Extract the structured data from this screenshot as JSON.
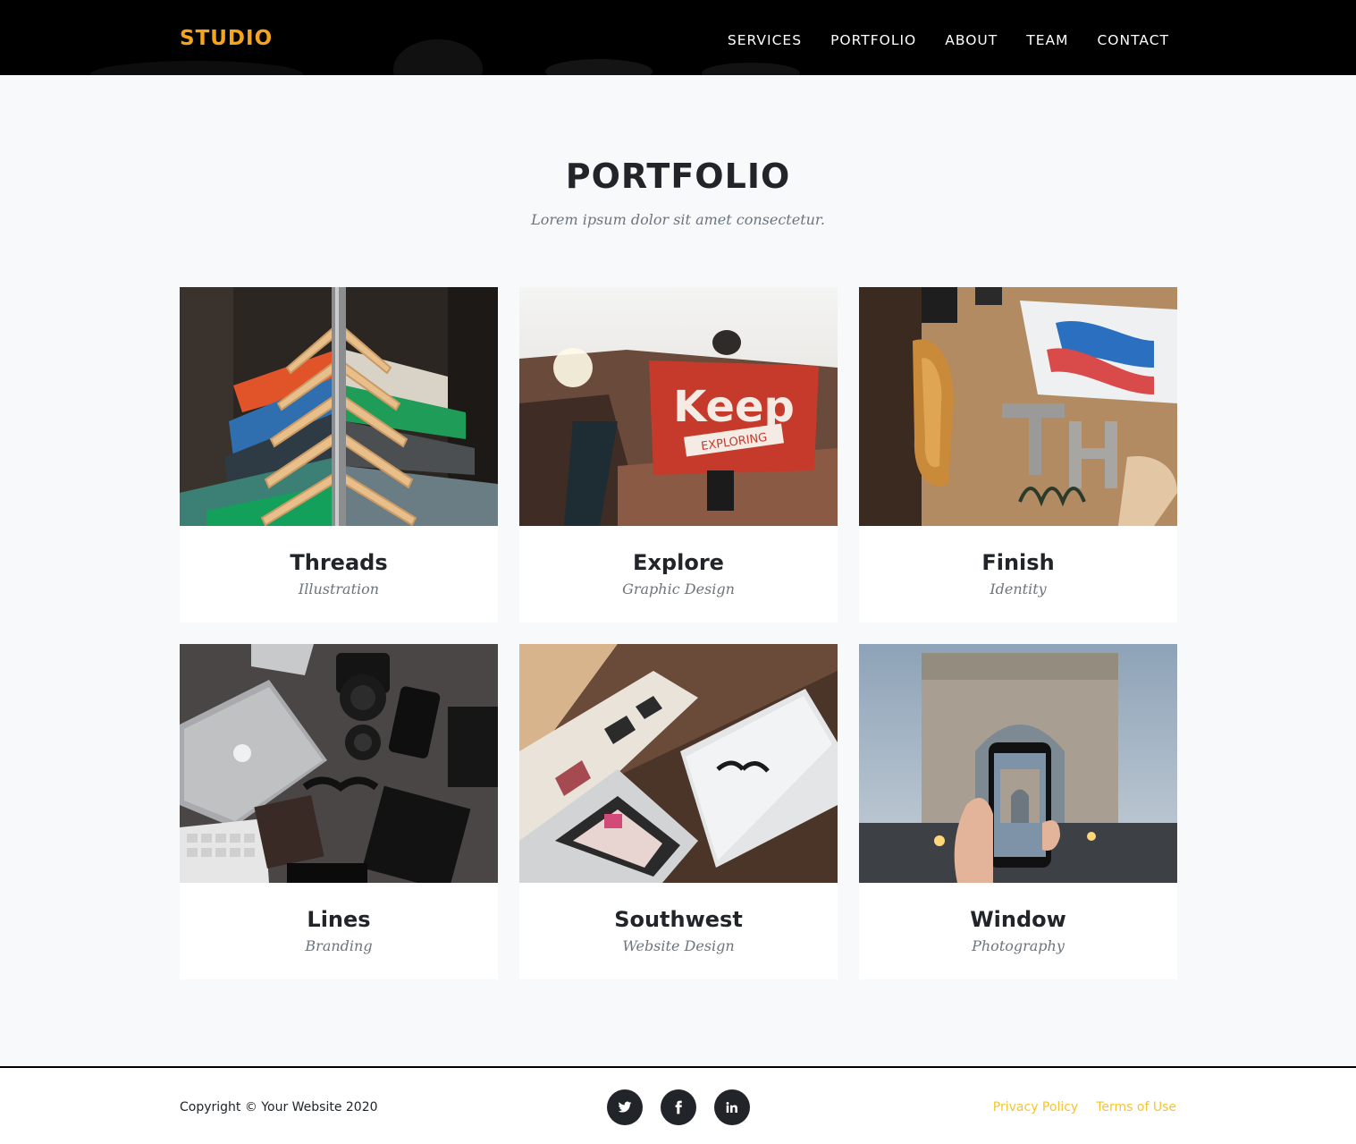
{
  "navbar": {
    "brand": "STUDIO",
    "links": [
      "SERVICES",
      "PORTFOLIO",
      "ABOUT",
      "TEAM",
      "CONTACT"
    ]
  },
  "portfolio": {
    "heading": "PORTFOLIO",
    "subheading": "Lorem ipsum dolor sit amet consectetur.",
    "items": [
      {
        "title": "Threads",
        "category": "Illustration",
        "image": "clothes-on-hangers-photo"
      },
      {
        "title": "Explore",
        "category": "Graphic Design",
        "image": "keep-exploring-flag-photo"
      },
      {
        "title": "Finish",
        "category": "Identity",
        "image": "workshop-letters-photo"
      },
      {
        "title": "Lines",
        "category": "Branding",
        "image": "laptop-camera-flatlay-photo"
      },
      {
        "title": "Southwest",
        "category": "Website Design",
        "image": "laptop-notebook-desk-photo"
      },
      {
        "title": "Window",
        "category": "Photography",
        "image": "arc-de-triomphe-phone-photo"
      }
    ]
  },
  "footer": {
    "copyright": "Copyright © Your Website 2020",
    "social": [
      "twitter-icon",
      "facebook-icon",
      "linkedin-icon"
    ],
    "links": [
      "Privacy Policy",
      "Terms of Use"
    ]
  },
  "colors": {
    "brand": "#f4a41f",
    "footer_link": "#f4c430",
    "text_dark": "#212529",
    "text_muted": "#6c757d",
    "page_bg": "#f8f9fa"
  }
}
